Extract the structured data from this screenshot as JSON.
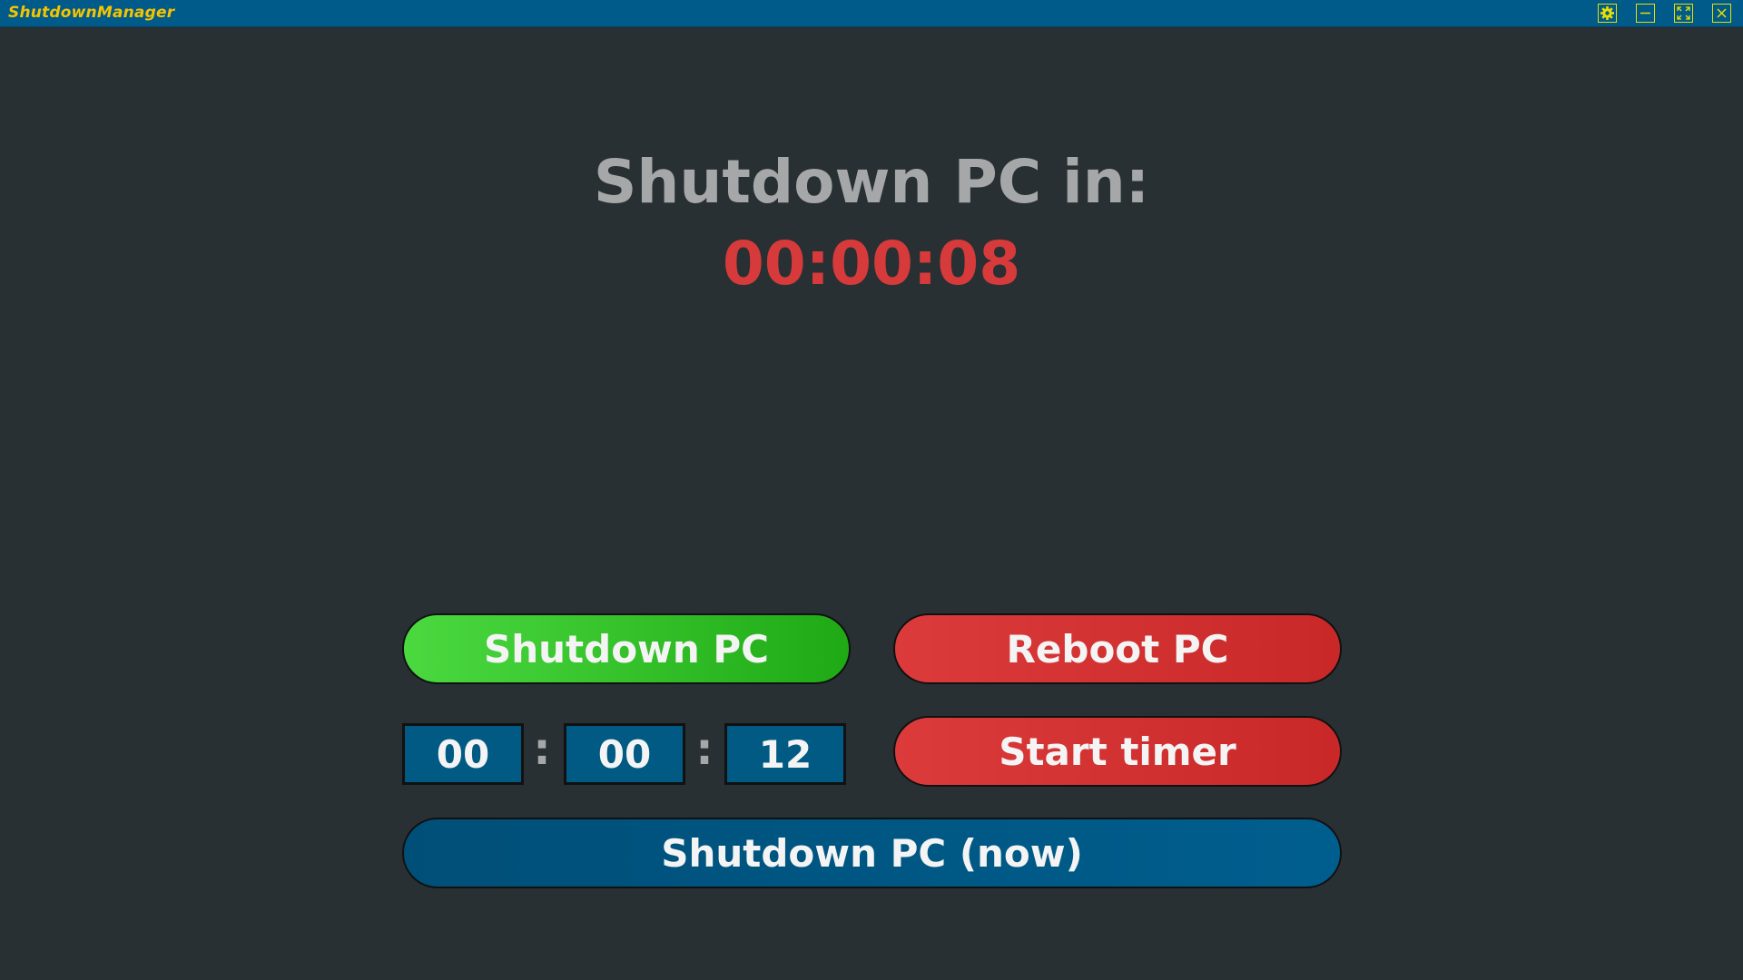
{
  "window": {
    "title": "ShutdownManager",
    "controls": {
      "settings_icon": "gear-icon",
      "minimize_icon": "minimize-icon",
      "maximize_icon": "maximize-icon",
      "close_icon": "close-icon"
    }
  },
  "main": {
    "heading": "Shutdown PC in:",
    "countdown": "00:00:08"
  },
  "buttons": {
    "shutdown_label": "Shutdown PC",
    "reboot_label": "Reboot PC",
    "start_timer_label": "Start timer",
    "shutdown_now_label": "Shutdown PC (now)"
  },
  "timer_inputs": {
    "hours": "00",
    "minutes": "00",
    "seconds": "12",
    "separator": ":"
  },
  "colors": {
    "background": "#283033",
    "titlebar": "#005a8a",
    "title_text": "#f5c400",
    "heading_text": "#a6a7a8",
    "countdown_text": "#d63a3a",
    "shutdown_button": "#32c22a",
    "reboot_button": "#d23232",
    "shutdown_now_button": "#005680",
    "window_control_accent": "#e8e000"
  }
}
